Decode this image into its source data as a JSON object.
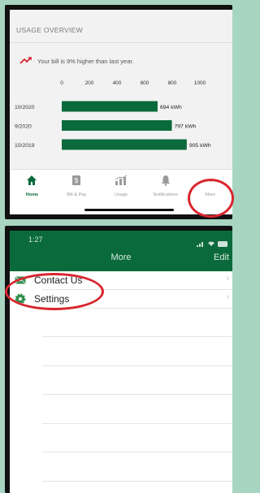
{
  "usage": {
    "title": "USAGE OVERVIEW",
    "trend_text": "Your bill is 9% higher than last year."
  },
  "chart_data": {
    "type": "bar",
    "orientation": "horizontal",
    "categories": [
      "10/2020",
      "9/2020",
      "10/2019"
    ],
    "values": [
      694,
      797,
      905
    ],
    "value_labels": [
      "694 kWh",
      "797 kWh",
      "905 kWh"
    ],
    "xticks": [
      "0",
      "200",
      "400",
      "600",
      "800",
      "1000"
    ],
    "xlim": [
      0,
      1000
    ],
    "bar_color": "#0b6a3c",
    "grid": false
  },
  "tabbar": {
    "items": [
      {
        "label": "Home",
        "icon": "home-icon",
        "active": true
      },
      {
        "label": "Bill & Pay",
        "icon": "bill-icon",
        "active": false
      },
      {
        "label": "Usage",
        "icon": "usage-chart-icon",
        "active": false
      },
      {
        "label": "Notifications",
        "icon": "bell-icon",
        "active": false
      },
      {
        "label": "More",
        "icon": "more-dots-icon",
        "active": false
      }
    ]
  },
  "more_screen": {
    "status_time": "1:27",
    "title": "More",
    "edit_label": "Edit",
    "items": [
      {
        "label": "Contact Us",
        "icon": "mail-icon"
      },
      {
        "label": "Settings",
        "icon": "gear-icon"
      }
    ]
  },
  "colors": {
    "brand_green": "#0b6a3c",
    "highlight_red": "#d8262e",
    "page_background": "#a8d5c2"
  }
}
